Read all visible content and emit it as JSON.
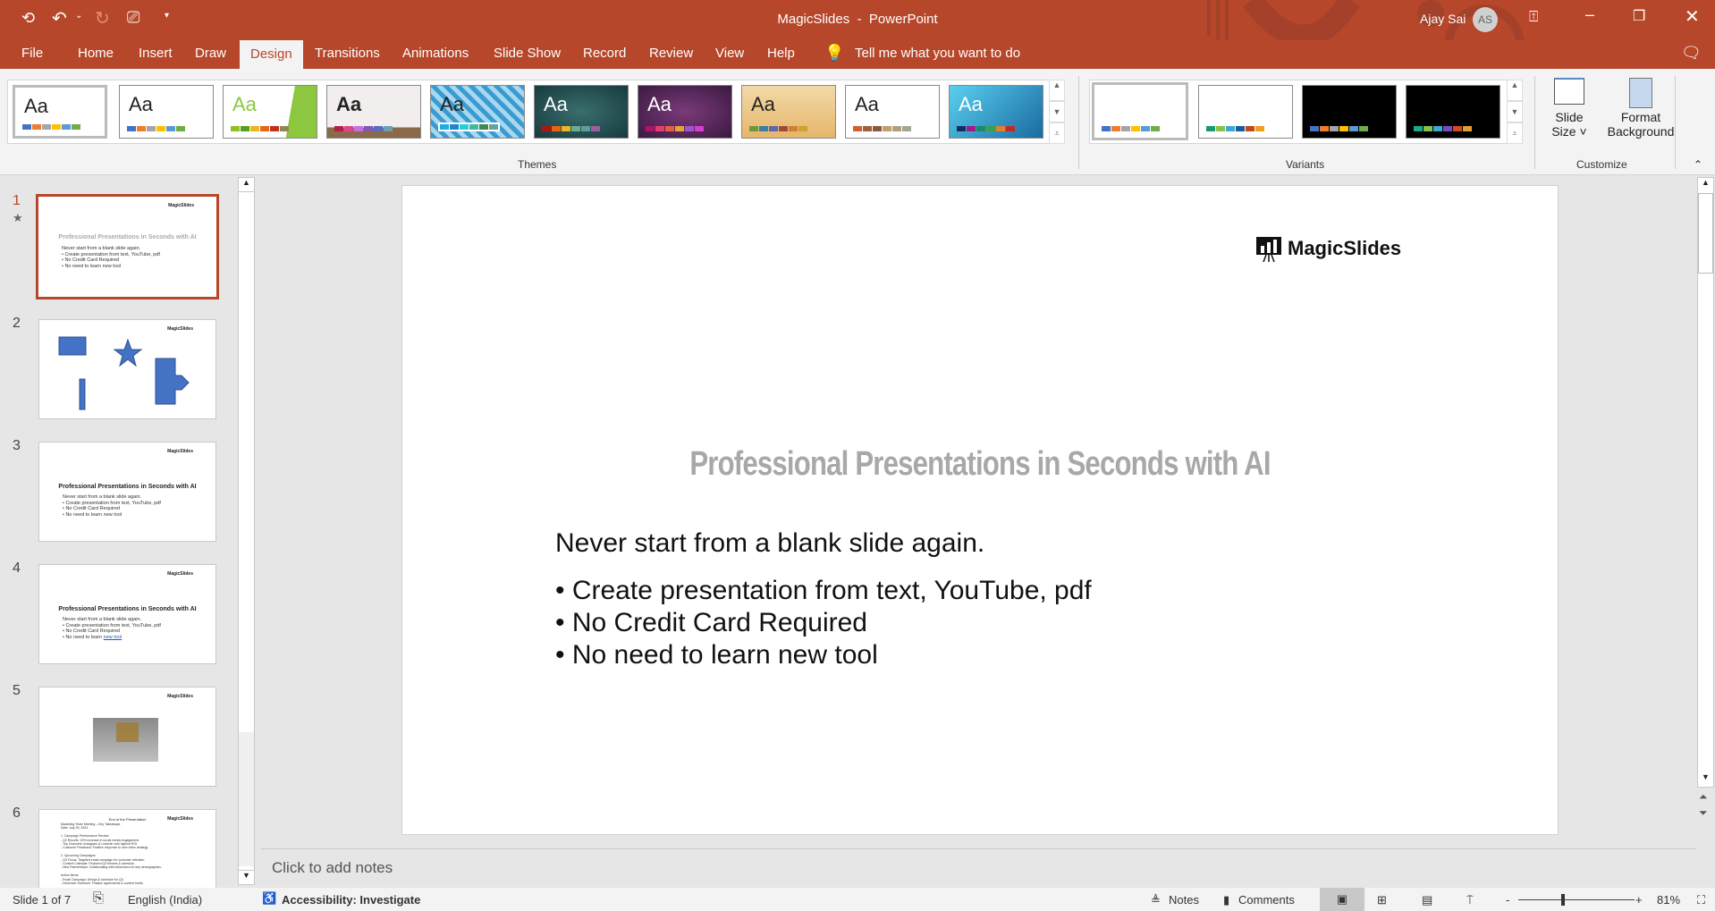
{
  "titlebar": {
    "document": "MagicSlides",
    "sep": "-",
    "app": "PowerPoint",
    "user": "Ajay Sai",
    "initials": "AS"
  },
  "tabs": [
    "File",
    "Home",
    "Insert",
    "Draw",
    "Design",
    "Transitions",
    "Animations",
    "Slide Show",
    "Record",
    "Review",
    "View",
    "Help"
  ],
  "active_tab": "Design",
  "tell_me": "Tell me what you want to do",
  "ribbon": {
    "themes_label": "Themes",
    "variants_label": "Variants",
    "customize_label": "Customize",
    "slide_size": "Slide",
    "slide_size2": "Size",
    "format_bg": "Format",
    "format_bg2": "Background",
    "theme_aa": "Aa"
  },
  "theme_colors": {
    "accent": "#b7472a"
  },
  "slides": {
    "s1": {
      "logo": "MagicSlides",
      "title": "Professional Presentations in Seconds with AI",
      "intro": "Never start from a blank slide again.",
      "b1": "• Create presentation from text, YouTube, pdf",
      "b2": "• No Credit Card Required",
      "b3": "• No need to learn new tool"
    },
    "s4link": "new tool",
    "s6": {
      "title": "End of the Presentation",
      "l1": "Marketing Team Meeting – Key Takeaways",
      "l2": "Date: July 25, 2024",
      "l3": "1. Campaign Performance Review:",
      "l4": "- Q2 Results: 19% increase in social media engagement.",
      "l5": "- Top Channels: Instagram & LinkedIn with highest ROI.",
      "l6": "- Customer Feedback: Positive response to new video strategy.",
      "l7": "2. Upcoming Campaigns:",
      "l8": "- Q3 Focus: Targeted email campaign for customer retention.",
      "l9": "- Content Calendar: Finalized Q3 themes & schedule.",
      "l10": "- New Partnerships: Collaborating with influencers for key demographics.",
      "l11": "Action Items:",
      "l12": "- Email Campaign: Design & schedule for Q3.",
      "l13": "- Influencer Outreach: Finalize agreements & content briefs."
    },
    "numbers": [
      "1",
      "2",
      "3",
      "4",
      "5",
      "6"
    ]
  },
  "notes_placeholder": "Click to add notes",
  "status": {
    "slide": "Slide 1 of 7",
    "language": "English (India)",
    "accessibility": "Accessibility: Investigate",
    "notes": "Notes",
    "comments": "Comments",
    "zoom": "81%",
    "minus": "-",
    "plus": "+"
  }
}
